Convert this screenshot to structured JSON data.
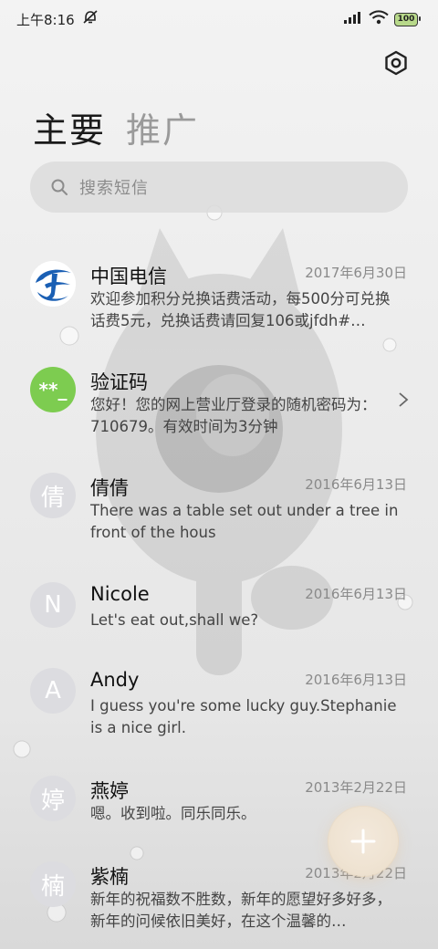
{
  "status_bar": {
    "time": "上午8:16",
    "battery": "100"
  },
  "tabs": [
    {
      "label": "主要",
      "active": true
    },
    {
      "label": "推广",
      "active": false
    }
  ],
  "search": {
    "placeholder": "搜索短信"
  },
  "conversations": [
    {
      "name": "中国电信",
      "date": "2017年6月30日",
      "preview": "欢迎参加积分兑换话费活动，每500分可兑换话费5元，兑换话费请回复106或jfdh#…",
      "avatar_type": "logo",
      "avatar_icon": "china-telecom-logo"
    },
    {
      "name": "验证码",
      "date": "",
      "preview": "您好！您的网上营业厅登录的随机密码为：710679。有效时间为3分钟",
      "avatar_type": "green",
      "avatar_text": "**_"
    },
    {
      "name": "倩倩",
      "date": "2016年6月13日",
      "preview": "There was a table set out under a tree in front of the hous",
      "avatar_type": "letter",
      "avatar_text": "倩"
    },
    {
      "name": "Nicole",
      "date": "2016年6月13日",
      "preview": "Let's eat out,shall we?",
      "avatar_type": "letter",
      "avatar_text": "N"
    },
    {
      "name": "Andy",
      "date": "2016年6月13日",
      "preview": "I guess you're some lucky guy.Stephanie is a nice girl.",
      "avatar_type": "letter",
      "avatar_text": "A"
    },
    {
      "name": "燕婷",
      "date": "2013年2月22日",
      "preview": "嗯。收到啦。同乐同乐。",
      "avatar_type": "letter",
      "avatar_text": "婷"
    },
    {
      "name": "紫楠",
      "date": "2013年2月22日",
      "preview": "新年的祝福数不胜数，新年的愿望好多好多，新年的问候依旧美好，在这个温馨的…",
      "avatar_type": "letter",
      "avatar_text": "楠"
    }
  ],
  "colors": {
    "accent_green": "#7dcc50",
    "telecom_blue": "#1a5fb4",
    "fab_tint": "#efe3d2"
  }
}
